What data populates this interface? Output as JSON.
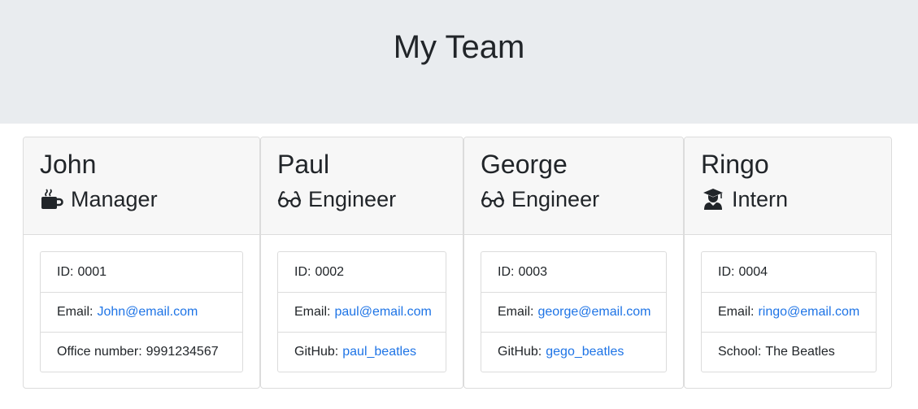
{
  "page": {
    "title": "My Team"
  },
  "team": [
    {
      "name": "John",
      "role": "Manager",
      "icon": "mug-icon",
      "rows": [
        {
          "label": "ID:",
          "value": "0001",
          "link": false
        },
        {
          "label": "Email:",
          "value": "John@email.com",
          "link": true
        },
        {
          "label": "Office number:",
          "value": "9991234567",
          "link": false
        }
      ]
    },
    {
      "name": "Paul",
      "role": "Engineer",
      "icon": "glasses-icon",
      "rows": [
        {
          "label": "ID:",
          "value": "0002",
          "link": false
        },
        {
          "label": "Email:",
          "value": "paul@email.com",
          "link": true
        },
        {
          "label": "GitHub:",
          "value": "paul_beatles",
          "link": true
        }
      ]
    },
    {
      "name": "George",
      "role": "Engineer",
      "icon": "glasses-icon",
      "rows": [
        {
          "label": "ID:",
          "value": "0003",
          "link": false
        },
        {
          "label": "Email:",
          "value": "george@email.com",
          "link": true
        },
        {
          "label": "GitHub:",
          "value": "gego_beatles",
          "link": true
        }
      ]
    },
    {
      "name": "Ringo",
      "role": "Intern",
      "icon": "graduate-icon",
      "rows": [
        {
          "label": "ID:",
          "value": "0004",
          "link": false
        },
        {
          "label": "Email:",
          "value": "ringo@email.com",
          "link": true
        },
        {
          "label": "School:",
          "value": "The Beatles",
          "link": false
        }
      ]
    }
  ],
  "colors": {
    "link": "#1e74e6",
    "header_bg": "#e9ecef",
    "card_header_bg": "#f7f7f7",
    "border": "#dcdcdc",
    "text": "#212529"
  }
}
